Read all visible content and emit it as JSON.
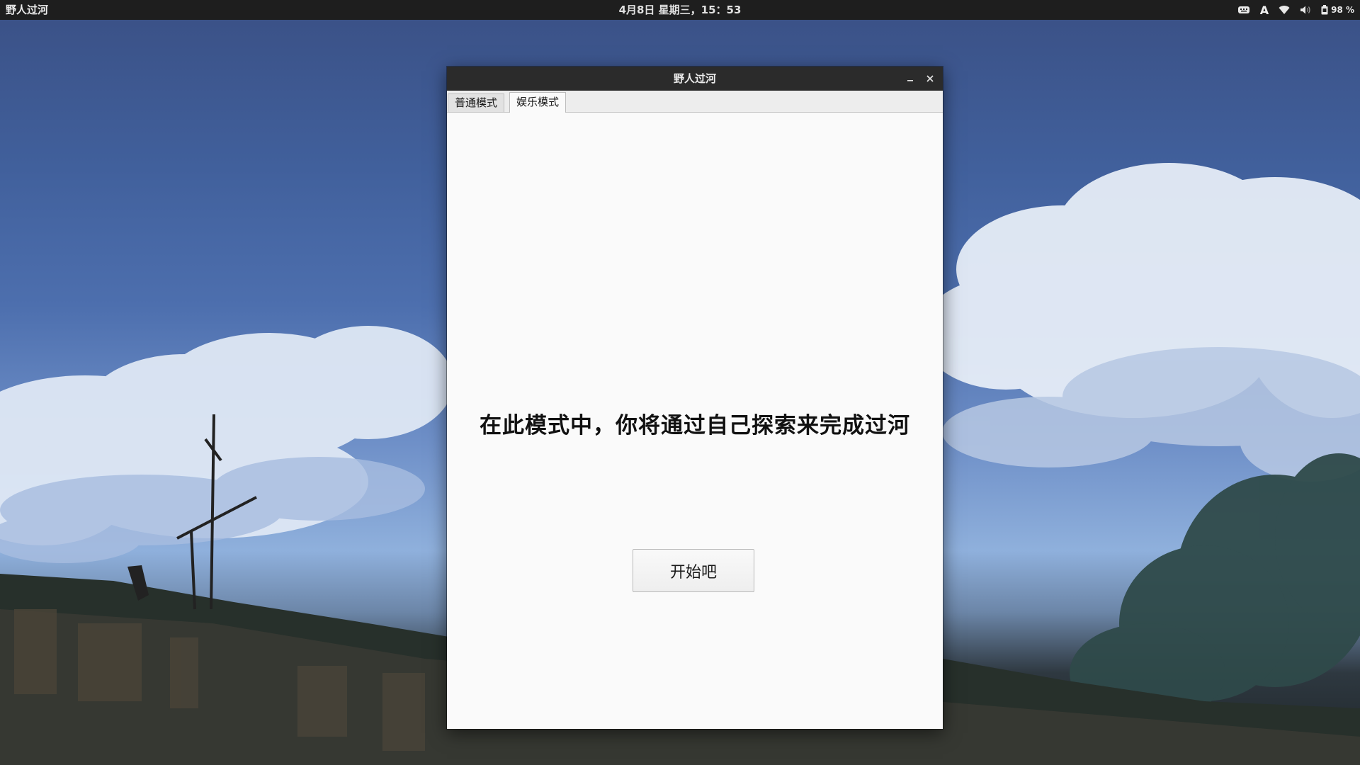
{
  "panel": {
    "app_name": "野人过河",
    "clock": "4月8日 星期三，15：53",
    "tray": {
      "input_method_label": "A",
      "battery_text": "98 %"
    }
  },
  "window": {
    "title": "野人过河",
    "tabs": [
      {
        "label": "普通模式",
        "selected": false
      },
      {
        "label": "娱乐模式",
        "selected": true
      }
    ],
    "message": "在此模式中，你将通过自己探索来完成过河",
    "start_button_label": "开始吧"
  },
  "icons": {
    "tray": [
      "keyboard-icon",
      "wifi-icon",
      "volume-icon",
      "battery-icon"
    ],
    "window_controls": [
      "minimize-icon",
      "close-icon"
    ]
  },
  "colors": {
    "panel_bg": "#1e1e1e",
    "titlebar_bg": "#2b2b2b",
    "window_bg": "#fafafa",
    "sky_blue": "#4d6fae"
  }
}
